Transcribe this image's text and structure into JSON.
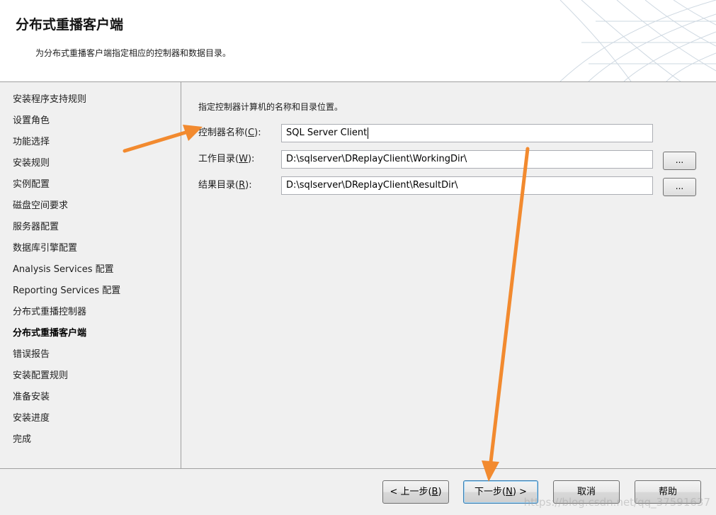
{
  "header": {
    "title": "分布式重播客户端",
    "subtitle": "为分布式重播客户端指定相应的控制器和数据目录。"
  },
  "sidebar": {
    "items": [
      {
        "label": "安装程序支持规则",
        "active": false
      },
      {
        "label": "设置角色",
        "active": false
      },
      {
        "label": "功能选择",
        "active": false
      },
      {
        "label": "安装规则",
        "active": false
      },
      {
        "label": "实例配置",
        "active": false
      },
      {
        "label": "磁盘空间要求",
        "active": false
      },
      {
        "label": "服务器配置",
        "active": false
      },
      {
        "label": "数据库引擎配置",
        "active": false
      },
      {
        "label": "Analysis Services 配置",
        "active": false
      },
      {
        "label": "Reporting Services 配置",
        "active": false
      },
      {
        "label": "分布式重播控制器",
        "active": false
      },
      {
        "label": "分布式重播客户端",
        "active": true
      },
      {
        "label": "错误报告",
        "active": false
      },
      {
        "label": "安装配置规则",
        "active": false
      },
      {
        "label": "准备安装",
        "active": false
      },
      {
        "label": "安装进度",
        "active": false
      },
      {
        "label": "完成",
        "active": false
      }
    ]
  },
  "main": {
    "instruction": "指定控制器计算机的名称和目录位置。",
    "controller_name": {
      "label": "控制器名称(",
      "hotkey": "C",
      "label_end": "):",
      "value": "SQL Server Client"
    },
    "working_dir": {
      "label": "工作目录(",
      "hotkey": "W",
      "label_end": "):",
      "value": "D:\\sqlserver\\DReplayClient\\WorkingDir\\",
      "browse_label": "..."
    },
    "result_dir": {
      "label": "结果目录(",
      "hotkey": "R",
      "label_end": "):",
      "value": "D:\\sqlserver\\DReplayClient\\ResultDir\\",
      "browse_label": "..."
    }
  },
  "footer": {
    "back": {
      "label": "< 上一步(",
      "hotkey": "B",
      "label_end": ")"
    },
    "next": {
      "label": "下一步(",
      "hotkey": "N",
      "label_end": ") >"
    },
    "cancel": {
      "label": "取消"
    },
    "help": {
      "label": "帮助"
    },
    "watermark": "https://blog.csdn.net/qq_37591637"
  },
  "colors": {
    "arrow": "#f28a2f",
    "panel_background": "#f0f0f0",
    "border": "#a0a0a0"
  }
}
